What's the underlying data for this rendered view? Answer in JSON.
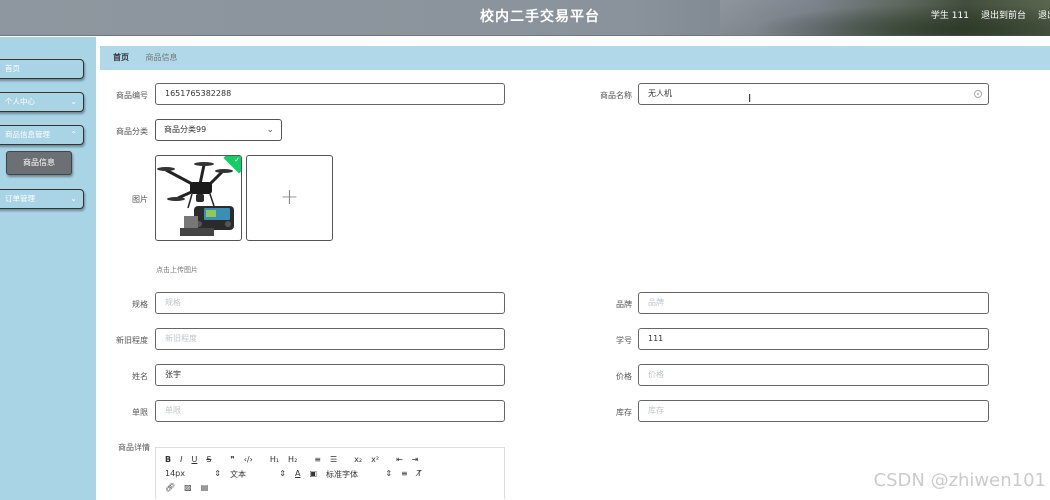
{
  "header": {
    "title": "校内二手交易平台",
    "nav": [
      "学生 111",
      "退出到前台",
      "退出"
    ]
  },
  "sidebar": {
    "items": [
      {
        "label": "首页"
      },
      {
        "label": "个人中心"
      },
      {
        "label": "商品信息管理"
      },
      {
        "label": "订单管理"
      }
    ],
    "sub_item": "商品信息"
  },
  "breadcrumb": {
    "home": "首页",
    "current": "商品信息"
  },
  "form": {
    "product_no": {
      "label": "商品编号",
      "value": "1651765382288"
    },
    "product_name": {
      "label": "商品名称",
      "value": "无人机"
    },
    "category": {
      "label": "商品分类",
      "value": "商品分类99"
    },
    "image": {
      "label": "图片",
      "hint": "点击上传图片"
    },
    "spec": {
      "label": "规格",
      "placeholder": "规格"
    },
    "brand": {
      "label": "品牌",
      "placeholder": "品牌"
    },
    "condition": {
      "label": "新旧程度",
      "placeholder": "新旧程度"
    },
    "student_no": {
      "label": "学号",
      "value": "111"
    },
    "name": {
      "label": "姓名",
      "value": "张宇"
    },
    "price": {
      "label": "价格",
      "placeholder": "价格"
    },
    "limit": {
      "label": "单限",
      "placeholder": "单限"
    },
    "stock": {
      "label": "库存",
      "placeholder": "库存"
    },
    "details": {
      "label": "商品详情"
    }
  },
  "editor": {
    "row1": [
      "B",
      "I",
      "U",
      "S",
      "❞",
      "‹/›",
      "H₁",
      "H₂",
      "≡",
      "☰",
      "x₂",
      "x²",
      "⇤",
      "⇥"
    ],
    "font_size": "14px",
    "text_type": "文本",
    "font_family": "标准字体"
  },
  "watermark": "CSDN @zhiwen101"
}
